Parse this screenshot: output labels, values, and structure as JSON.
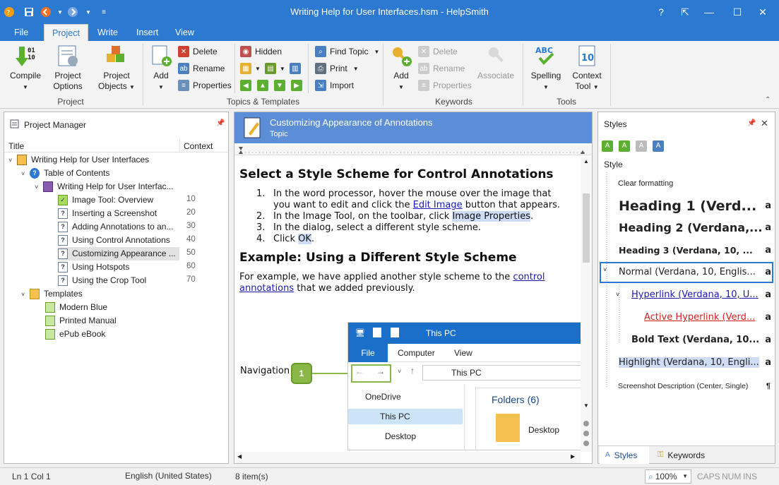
{
  "window": {
    "title": "Writing Help for User Interfaces.hsm - HelpSmith",
    "controls": {
      "help": "?",
      "restore_ribbon": "⇱",
      "minimize": "—",
      "maximize": "☐",
      "close": "✕"
    }
  },
  "quick_access": {
    "icons": [
      "app-icon",
      "save-icon",
      "back-icon",
      "forward-icon",
      "customize-icon"
    ]
  },
  "menu": {
    "tabs": [
      "File",
      "Project",
      "Write",
      "Insert",
      "View"
    ],
    "active": "Project"
  },
  "ribbon": {
    "project": {
      "label": "Project",
      "compile": "Compile",
      "options_l1": "Project",
      "options_l2": "Options",
      "objects_l1": "Project",
      "objects_l2": "Objects"
    },
    "topics": {
      "label": "Topics & Templates",
      "add": "Add",
      "delete": "Delete",
      "rename": "Rename",
      "properties": "Properties",
      "hidden": "Hidden",
      "find_topic": "Find Topic",
      "print": "Print",
      "import": "Import"
    },
    "keywords": {
      "label": "Keywords",
      "add": "Add",
      "delete": "Delete",
      "rename": "Rename",
      "properties": "Properties",
      "associate": "Associate"
    },
    "tools": {
      "label": "Tools",
      "spelling": "Spelling",
      "context_l1": "Context",
      "context_l2": "Tool"
    }
  },
  "project_manager": {
    "title": "Project Manager",
    "col_title": "Title",
    "col_context": "Context",
    "root": "Writing Help for User Interfaces",
    "toc": "Table of Contents",
    "book": "Writing Help for User Interfac...",
    "topics": [
      {
        "label": "Image Tool: Overview",
        "context": "10"
      },
      {
        "label": "Inserting a Screenshot",
        "context": "20"
      },
      {
        "label": "Adding Annotations to an...",
        "context": "30"
      },
      {
        "label": "Using Control Annotations",
        "context": "40"
      },
      {
        "label": "Customizing Appearance ...",
        "context": "50"
      },
      {
        "label": "Using Hotspots",
        "context": "60"
      },
      {
        "label": "Using the Crop Tool",
        "context": "70"
      }
    ],
    "templates_folder": "Templates",
    "templates": [
      "Modern Blue",
      "Printed Manual",
      "ePub eBook"
    ]
  },
  "editor": {
    "topic_title": "Customizing Appearance of Annotations",
    "topic_type": "Topic",
    "h1": "Select a Style Scheme for Control Annotations",
    "steps": {
      "s1a": "In the word processor, hover the mouse over the image that",
      "s1b": "you want to edit and click the ",
      "s1_link": "Edit Image",
      "s1c": " button that appears.",
      "s2a": "In the Image Tool, on the toolbar, click ",
      "s2_hl": "Image Properties",
      "s2b": ".",
      "s3": "In the dialog, select a different style scheme.",
      "s4a": "Click ",
      "s4_hl": "OK",
      "s4b": "."
    },
    "numbers": [
      "1.",
      "2.",
      "3.",
      "4."
    ],
    "h2": "Example: Using a Different Style Scheme",
    "para_a": "For example, we have applied another style scheme to the ",
    "para_link1": "control",
    "para_link2": "annotations",
    "para_b": " that we added previously.",
    "callout_label": "Navigation",
    "callout_num": "1",
    "screenshot": {
      "title": "This PC",
      "tabs": [
        "File",
        "Computer",
        "View"
      ],
      "address": "This PC",
      "nav": [
        "OneDrive",
        "This PC",
        "Desktop"
      ],
      "folders": "Folders (6)",
      "folder_item": "Desktop"
    }
  },
  "styles_panel": {
    "title": "Styles",
    "col": "Style",
    "items": [
      {
        "label": "Clear formatting",
        "mark": ""
      },
      {
        "label": "Heading 1 (Verd...",
        "mark": "a"
      },
      {
        "label": "Heading 2 (Verdana,...",
        "mark": "a"
      },
      {
        "label": "Heading 3 (Verdana, 10, ...",
        "mark": "a"
      },
      {
        "label": "Normal (Verdana, 10, Englis...",
        "mark": "a"
      },
      {
        "label": "Hyperlink (Verdana, 10, U...",
        "mark": "a"
      },
      {
        "label": "Active Hyperlink (Verd...",
        "mark": "a"
      },
      {
        "label": "Bold Text (Verdana, 10...",
        "mark": "a"
      },
      {
        "label": "Highlight (Verdana, 10, Engli...",
        "mark": "a"
      },
      {
        "label": "Screenshot Description (Center, Single)",
        "mark": "¶"
      }
    ],
    "tabs": {
      "styles": "Styles",
      "keywords": "Keywords"
    }
  },
  "status": {
    "position": "Ln 1 Col 1",
    "language": "English (United States)",
    "items": "8 item(s)",
    "zoom": "100%",
    "caps": "CAPS",
    "num": "NUM",
    "ins": "INS"
  },
  "colors": {
    "accent": "#2b79d0",
    "topic_header": "#5b8ed6",
    "highlight": "#cfdcf5",
    "active_link": "#d42020"
  }
}
